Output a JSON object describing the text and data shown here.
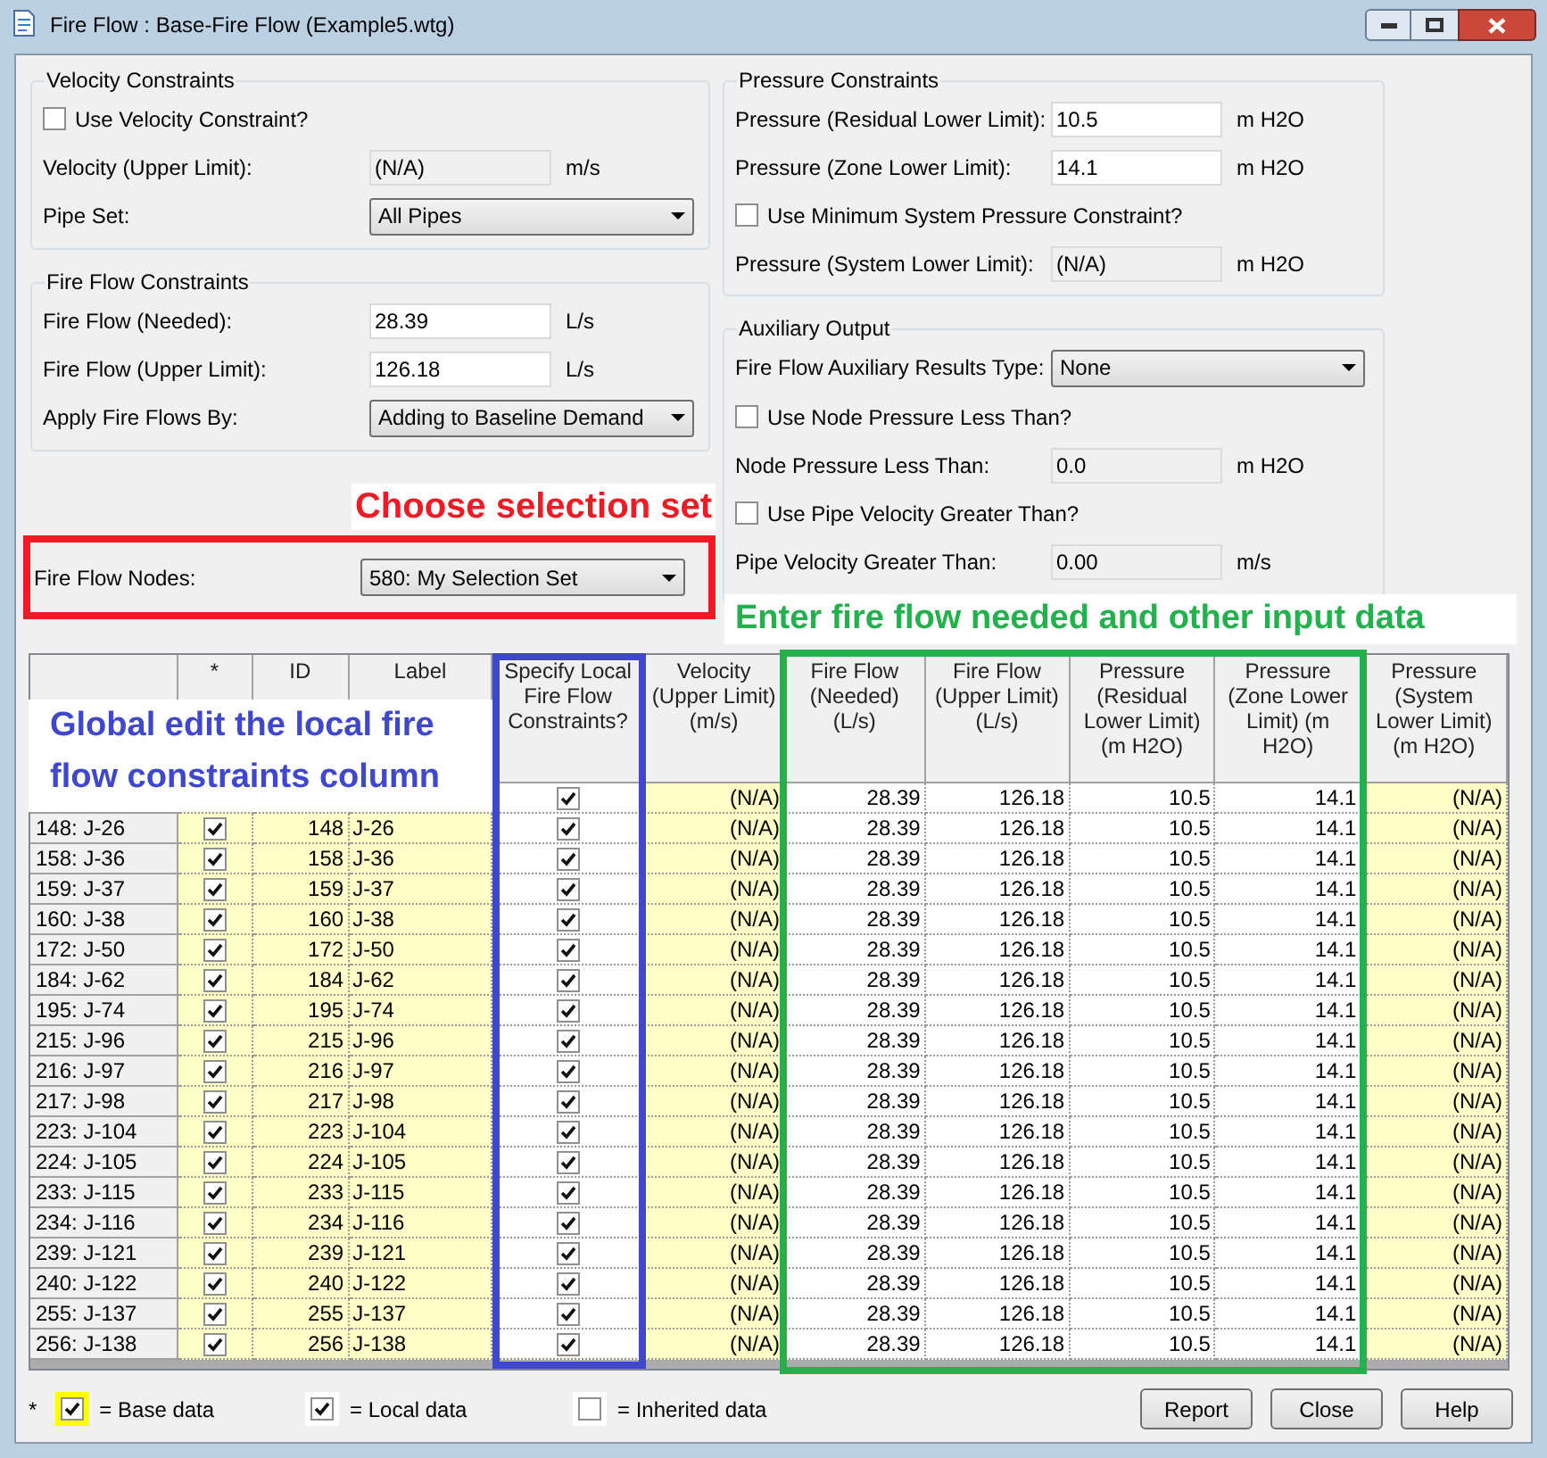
{
  "window": {
    "title": "Fire Flow : Base-Fire Flow (Example5.wtg)"
  },
  "groups_left": [
    {
      "title": "Velocity Constraints",
      "items": [
        {
          "kind": "checkbox",
          "label": "Use Velocity Constraint?",
          "checked": false
        },
        {
          "kind": "text",
          "label": "Velocity (Upper Limit):",
          "value": "(N/A)",
          "unit": "m/s",
          "disabled": true
        },
        {
          "kind": "dropdown",
          "label": "Pipe Set:",
          "value": "All Pipes"
        }
      ]
    },
    {
      "title": "Fire Flow Constraints",
      "items": [
        {
          "kind": "text",
          "label": "Fire Flow (Needed):",
          "value": "28.39",
          "unit": "L/s",
          "disabled": false
        },
        {
          "kind": "text",
          "label": "Fire Flow (Upper Limit):",
          "value": "126.18",
          "unit": "L/s",
          "disabled": false
        },
        {
          "kind": "dropdown",
          "label": "Apply Fire Flows By:",
          "value": "Adding to Baseline Demand"
        }
      ]
    }
  ],
  "groups_right": [
    {
      "title": "Pressure Constraints",
      "items": [
        {
          "kind": "text",
          "label": "Pressure (Residual Lower Limit):",
          "value": "10.5",
          "unit": "m H2O",
          "disabled": false
        },
        {
          "kind": "text",
          "label": "Pressure (Zone Lower Limit):",
          "value": "14.1",
          "unit": "m H2O",
          "disabled": false
        },
        {
          "kind": "checkbox",
          "label": "Use Minimum System Pressure Constraint?",
          "checked": false
        },
        {
          "kind": "text",
          "label": "Pressure (System Lower Limit):",
          "value": "(N/A)",
          "unit": "m H2O",
          "disabled": true
        }
      ]
    },
    {
      "title": "Auxiliary Output",
      "items": [
        {
          "kind": "dropdown",
          "label": "Fire Flow Auxiliary Results Type:",
          "value": "None"
        },
        {
          "kind": "checkbox",
          "label": "Use Node Pressure Less Than?",
          "checked": false
        },
        {
          "kind": "text",
          "label": "Node Pressure Less Than:",
          "value": "0.0",
          "unit": "m H2O",
          "disabled": true
        },
        {
          "kind": "checkbox",
          "label": "Use Pipe Velocity Greater Than?",
          "checked": false
        },
        {
          "kind": "text",
          "label": "Pipe Velocity Greater Than:",
          "value": "0.00",
          "unit": "m/s",
          "disabled": true
        }
      ]
    }
  ],
  "fire_flow_nodes": {
    "label": "Fire Flow Nodes:",
    "value": "580: My Selection Set"
  },
  "annotations": [
    {
      "text": "Choose selection set",
      "color": "#ed1c24"
    },
    {
      "text": "Enter fire flow needed and other input data",
      "color": "#22b14c"
    },
    {
      "text": "Global edit the local fire flow constraints column",
      "color": "#3f48cc"
    }
  ],
  "table": {
    "columns": [
      {
        "label": "*",
        "kind": "check",
        "local": false
      },
      {
        "label": "ID",
        "kind": "number",
        "local": false
      },
      {
        "label": "Label",
        "kind": "text",
        "local": false
      },
      {
        "label": "Specify Local Fire Flow Constraints?",
        "kind": "check",
        "local": true
      },
      {
        "label": "Velocity (Upper Limit) (m/s)",
        "kind": "number",
        "local": false
      },
      {
        "label": "Fire Flow (Needed) (L/s)",
        "kind": "number",
        "local": true
      },
      {
        "label": "Fire Flow (Upper Limit) (L/s)",
        "kind": "number",
        "local": true
      },
      {
        "label": "Pressure (Residual Lower Limit) (m H2O)",
        "kind": "number",
        "local": true
      },
      {
        "label": "Pressure (Zone Lower Limit) (m H2O)",
        "kind": "number",
        "local": true
      },
      {
        "label": "Pressure (System Lower Limit) (m H2O)",
        "kind": "number",
        "local": false
      }
    ],
    "rows": [
      {
        "cells": [
          null,
          null,
          null,
          true,
          "(N/A)",
          "28.39",
          "126.18",
          "10.5",
          "14.1",
          "(N/A)"
        ]
      },
      {
        "node": "148: J-26",
        "cells": [
          true,
          "148",
          "J-26",
          true,
          "(N/A)",
          "28.39",
          "126.18",
          "10.5",
          "14.1",
          "(N/A)"
        ]
      },
      {
        "node": "158: J-36",
        "cells": [
          true,
          "158",
          "J-36",
          true,
          "(N/A)",
          "28.39",
          "126.18",
          "10.5",
          "14.1",
          "(N/A)"
        ]
      },
      {
        "node": "159: J-37",
        "cells": [
          true,
          "159",
          "J-37",
          true,
          "(N/A)",
          "28.39",
          "126.18",
          "10.5",
          "14.1",
          "(N/A)"
        ]
      },
      {
        "node": "160: J-38",
        "cells": [
          true,
          "160",
          "J-38",
          true,
          "(N/A)",
          "28.39",
          "126.18",
          "10.5",
          "14.1",
          "(N/A)"
        ]
      },
      {
        "node": "172: J-50",
        "cells": [
          true,
          "172",
          "J-50",
          true,
          "(N/A)",
          "28.39",
          "126.18",
          "10.5",
          "14.1",
          "(N/A)"
        ]
      },
      {
        "node": "184: J-62",
        "cells": [
          true,
          "184",
          "J-62",
          true,
          "(N/A)",
          "28.39",
          "126.18",
          "10.5",
          "14.1",
          "(N/A)"
        ]
      },
      {
        "node": "195: J-74",
        "cells": [
          true,
          "195",
          "J-74",
          true,
          "(N/A)",
          "28.39",
          "126.18",
          "10.5",
          "14.1",
          "(N/A)"
        ]
      },
      {
        "node": "215: J-96",
        "cells": [
          true,
          "215",
          "J-96",
          true,
          "(N/A)",
          "28.39",
          "126.18",
          "10.5",
          "14.1",
          "(N/A)"
        ]
      },
      {
        "node": "216: J-97",
        "cells": [
          true,
          "216",
          "J-97",
          true,
          "(N/A)",
          "28.39",
          "126.18",
          "10.5",
          "14.1",
          "(N/A)"
        ]
      },
      {
        "node": "217: J-98",
        "cells": [
          true,
          "217",
          "J-98",
          true,
          "(N/A)",
          "28.39",
          "126.18",
          "10.5",
          "14.1",
          "(N/A)"
        ]
      },
      {
        "node": "223: J-104",
        "cells": [
          true,
          "223",
          "J-104",
          true,
          "(N/A)",
          "28.39",
          "126.18",
          "10.5",
          "14.1",
          "(N/A)"
        ]
      },
      {
        "node": "224: J-105",
        "cells": [
          true,
          "224",
          "J-105",
          true,
          "(N/A)",
          "28.39",
          "126.18",
          "10.5",
          "14.1",
          "(N/A)"
        ]
      },
      {
        "node": "233: J-115",
        "cells": [
          true,
          "233",
          "J-115",
          true,
          "(N/A)",
          "28.39",
          "126.18",
          "10.5",
          "14.1",
          "(N/A)"
        ]
      },
      {
        "node": "234: J-116",
        "cells": [
          true,
          "234",
          "J-116",
          true,
          "(N/A)",
          "28.39",
          "126.18",
          "10.5",
          "14.1",
          "(N/A)"
        ]
      },
      {
        "node": "239: J-121",
        "cells": [
          true,
          "239",
          "J-121",
          true,
          "(N/A)",
          "28.39",
          "126.18",
          "10.5",
          "14.1",
          "(N/A)"
        ]
      },
      {
        "node": "240: J-122",
        "cells": [
          true,
          "240",
          "J-122",
          true,
          "(N/A)",
          "28.39",
          "126.18",
          "10.5",
          "14.1",
          "(N/A)"
        ]
      },
      {
        "node": "255: J-137",
        "cells": [
          true,
          "255",
          "J-137",
          true,
          "(N/A)",
          "28.39",
          "126.18",
          "10.5",
          "14.1",
          "(N/A)"
        ]
      },
      {
        "node": "256: J-138",
        "cells": [
          true,
          "256",
          "J-138",
          true,
          "(N/A)",
          "28.39",
          "126.18",
          "10.5",
          "14.1",
          "(N/A)"
        ]
      }
    ]
  },
  "legend": [
    {
      "mark": "*",
      "kind": "base",
      "checked": true,
      "label": "= Base data"
    },
    {
      "kind": "local",
      "checked": true,
      "label": "= Local data"
    },
    {
      "kind": "inherited",
      "checked": false,
      "label": "= Inherited data"
    }
  ],
  "buttons": [
    "Report",
    "Close",
    "Help"
  ]
}
